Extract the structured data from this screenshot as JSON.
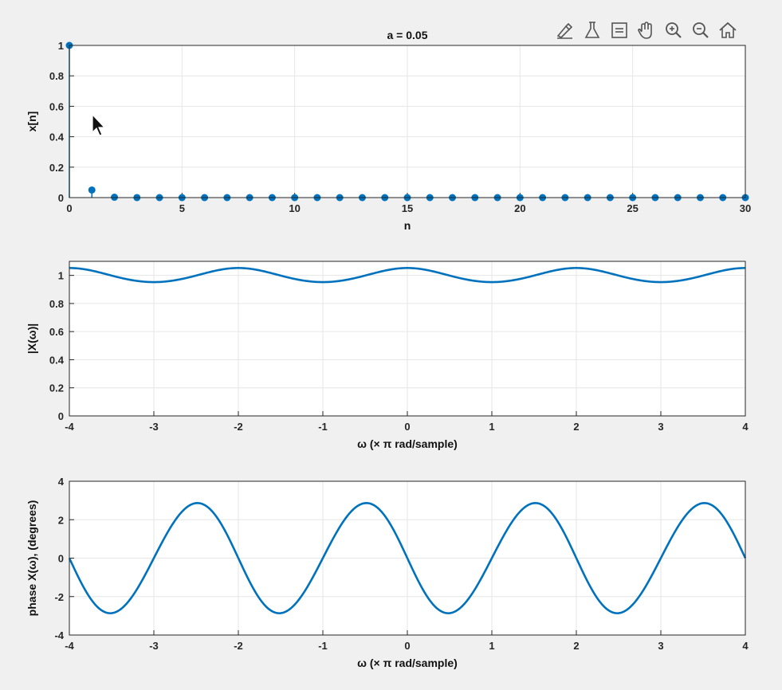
{
  "toolbar": {
    "icons": [
      "brush-icon",
      "data-tips-icon",
      "datatip-box-icon",
      "pan-hand-icon",
      "zoom-in-icon",
      "zoom-out-icon",
      "home-icon"
    ]
  },
  "colors": {
    "series": "#0072BD",
    "axes": "#262626",
    "grid": "#e6e6e6",
    "bg": "#ffffff"
  },
  "chart_data": [
    {
      "type": "scatter",
      "style": "stem",
      "title": "a = 0.05",
      "xlabel": "n",
      "ylabel": "x[n]",
      "xlim": [
        0,
        30
      ],
      "ylim": [
        0,
        1
      ],
      "xticks": [
        "0",
        "5",
        "10",
        "15",
        "20",
        "25",
        "30"
      ],
      "yticks": [
        "0",
        "0.2",
        "0.4",
        "0.6",
        "0.8",
        "1"
      ],
      "grid": true,
      "x": [
        0,
        1,
        2,
        3,
        4,
        5,
        6,
        7,
        8,
        9,
        10,
        11,
        12,
        13,
        14,
        15,
        16,
        17,
        18,
        19,
        20,
        21,
        22,
        23,
        24,
        25,
        26,
        27,
        28,
        29,
        30
      ],
      "y": [
        1,
        0.05,
        0.0025,
        0.000125,
        0,
        0,
        0,
        0,
        0,
        0,
        0,
        0,
        0,
        0,
        0,
        0,
        0,
        0,
        0,
        0,
        0,
        0,
        0,
        0,
        0,
        0,
        0,
        0,
        0,
        0,
        0
      ]
    },
    {
      "type": "line",
      "title": "",
      "xlabel": "ω (× π rad/sample)",
      "ylabel": "|X(ω)|",
      "xlim": [
        -4,
        4
      ],
      "ylim": [
        0,
        1.1
      ],
      "xticks": [
        "-4",
        "-3",
        "-2",
        "-1",
        "0",
        "1",
        "2",
        "3",
        "4"
      ],
      "yticks": [
        "0",
        "0.2",
        "0.4",
        "0.6",
        "0.8",
        "1"
      ],
      "grid": true,
      "x": [
        -4,
        -3.5,
        -3,
        -2.5,
        -2,
        -1.5,
        -1,
        -0.5,
        0,
        0.5,
        1,
        1.5,
        2,
        2.5,
        3,
        3.5,
        4
      ],
      "y": [
        1.0526,
        1.0012,
        0.9524,
        1.0012,
        1.0526,
        1.0012,
        0.9524,
        1.0012,
        1.0526,
        1.0012,
        0.9524,
        1.0012,
        1.0526,
        1.0012,
        0.9524,
        1.0012,
        1.0526
      ]
    },
    {
      "type": "line",
      "title": "",
      "xlabel": "ω (× π rad/sample)",
      "ylabel": "phase X(ω), (degrees)",
      "xlim": [
        -4,
        4
      ],
      "ylim": [
        -4,
        4
      ],
      "xticks": [
        "-4",
        "-3",
        "-2",
        "-1",
        "0",
        "1",
        "2",
        "3",
        "4"
      ],
      "yticks": [
        "-4",
        "-2",
        "0",
        "2",
        "4"
      ],
      "grid": true,
      "x": [
        -4,
        -3.5,
        -3,
        -2.5,
        -2,
        -1.5,
        -1,
        -0.5,
        0,
        0.5,
        1,
        1.5,
        2,
        2.5,
        3,
        3.5,
        4
      ],
      "y": [
        0,
        -2.86,
        0,
        2.86,
        0,
        -2.86,
        0,
        2.86,
        0,
        -2.86,
        0,
        2.86,
        0,
        -2.86,
        0,
        2.86,
        0
      ]
    }
  ]
}
